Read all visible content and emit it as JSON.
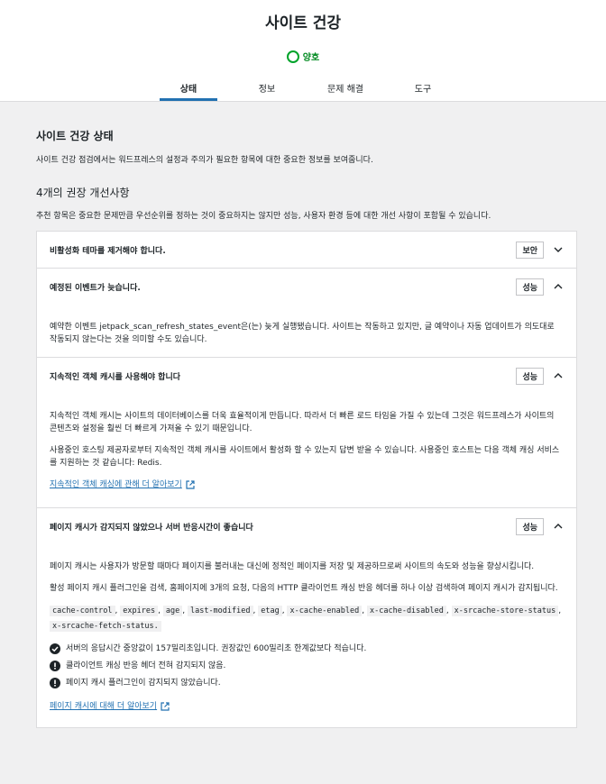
{
  "header": {
    "title": "사이트 건강",
    "status_label": "양호",
    "tabs": [
      {
        "label": "상태",
        "active": true
      },
      {
        "label": "정보",
        "active": false
      },
      {
        "label": "문제 해결",
        "active": false
      },
      {
        "label": "도구",
        "active": false
      }
    ]
  },
  "main": {
    "section_title": "사이트 건강 상태",
    "section_desc": "사이트 건강 점검에서는 워드프레스의 설정과 주의가 필요한 항목에 대한 중요한 정보를 보여줍니다.",
    "recommend_title": "4개의 권장 개선사항",
    "recommend_desc": "추천 항목은 중요한 문제만큼 우선순위를 정하는 것이 중요하지는 않지만 성능, 사용자 환경 등에 대한 개선 사항이 포함될 수 있습니다.",
    "items": [
      {
        "label": "비활성화 테마를 제거해야 합니다.",
        "badge": "보안"
      },
      {
        "label": "예정된 이벤트가 늦습니다.",
        "badge": "성능",
        "body": "예약한 이벤트 jetpack_scan_refresh_states_event은(는) 늦게 실행됐습니다. 사이트는 작동하고 있지만, 글 예약이나 자동 업데이트가 의도대로 작동되지 않는다는 것을 의미할 수도 있습니다."
      },
      {
        "label": "지속적인 객체 캐시를 사용해야 합니다",
        "badge": "성능",
        "body1": "지속적인 객체 캐시는 사이트의 데이터베이스를 더욱 효율적이게 만듭니다. 따라서 더 빠른 로드 타임을 가질 수 있는데 그것은 워드프레스가 사이트의 콘텐츠와 설정을 훨씬 더 빠르게 가져올 수 있기 때문입니다.",
        "body2": "사용중인 호스팅 제공자로부터 지속적인 객체 캐시를 사이트에서 활성화 할 수 있는지 답변 받을 수 있습니다. 사용중인 호스트는 다음 객체 캐싱 서비스를 지원하는 것 같습니다: Redis.",
        "link": "지속적인 객체 캐싱에 관해 더 알아보기"
      },
      {
        "label": "페이지 캐시가 감지되지 않았으나 서버 반응시간이 좋습니다",
        "badge": "성능",
        "body1": "페이지 캐시는 사용자가 방문할 때마다 페이지를 불러내는 대신에 정적인 페이지를 저장 및 제공하므로써 사이트의 속도와 성능을 향상시킵니다.",
        "body2": "활성 페이지 캐시 플러그인을 검색, 홈페이지에 3개의 요청, 다음의 HTTP 클라이언트 캐싱 반응 헤더를 하나 이상 검색하여 페이지 캐시가 감지됩니다.",
        "headers": [
          "cache-control",
          "expires",
          "age",
          "last-modified",
          "etag",
          "x-cache-enabled",
          "x-cache-disabled",
          "x-srcache-store-status",
          "x-srcache-fetch-status."
        ],
        "sep": ",",
        "checks": [
          {
            "icon": "check-circle-icon",
            "text": "서버의 응답시간 중앙값이 157밀리초입니다. 권장값인 600밀리초 한계값보다 적습니다."
          },
          {
            "icon": "warning-icon",
            "text": "클라이언트 캐싱 반응 헤더 전혀 감지되지 않음."
          },
          {
            "icon": "warning-icon",
            "text": "페이지 캐시 플러그인이 감지되지 않았습니다."
          }
        ],
        "link": "페이지 캐시에 대해 더 알아보기"
      }
    ]
  }
}
